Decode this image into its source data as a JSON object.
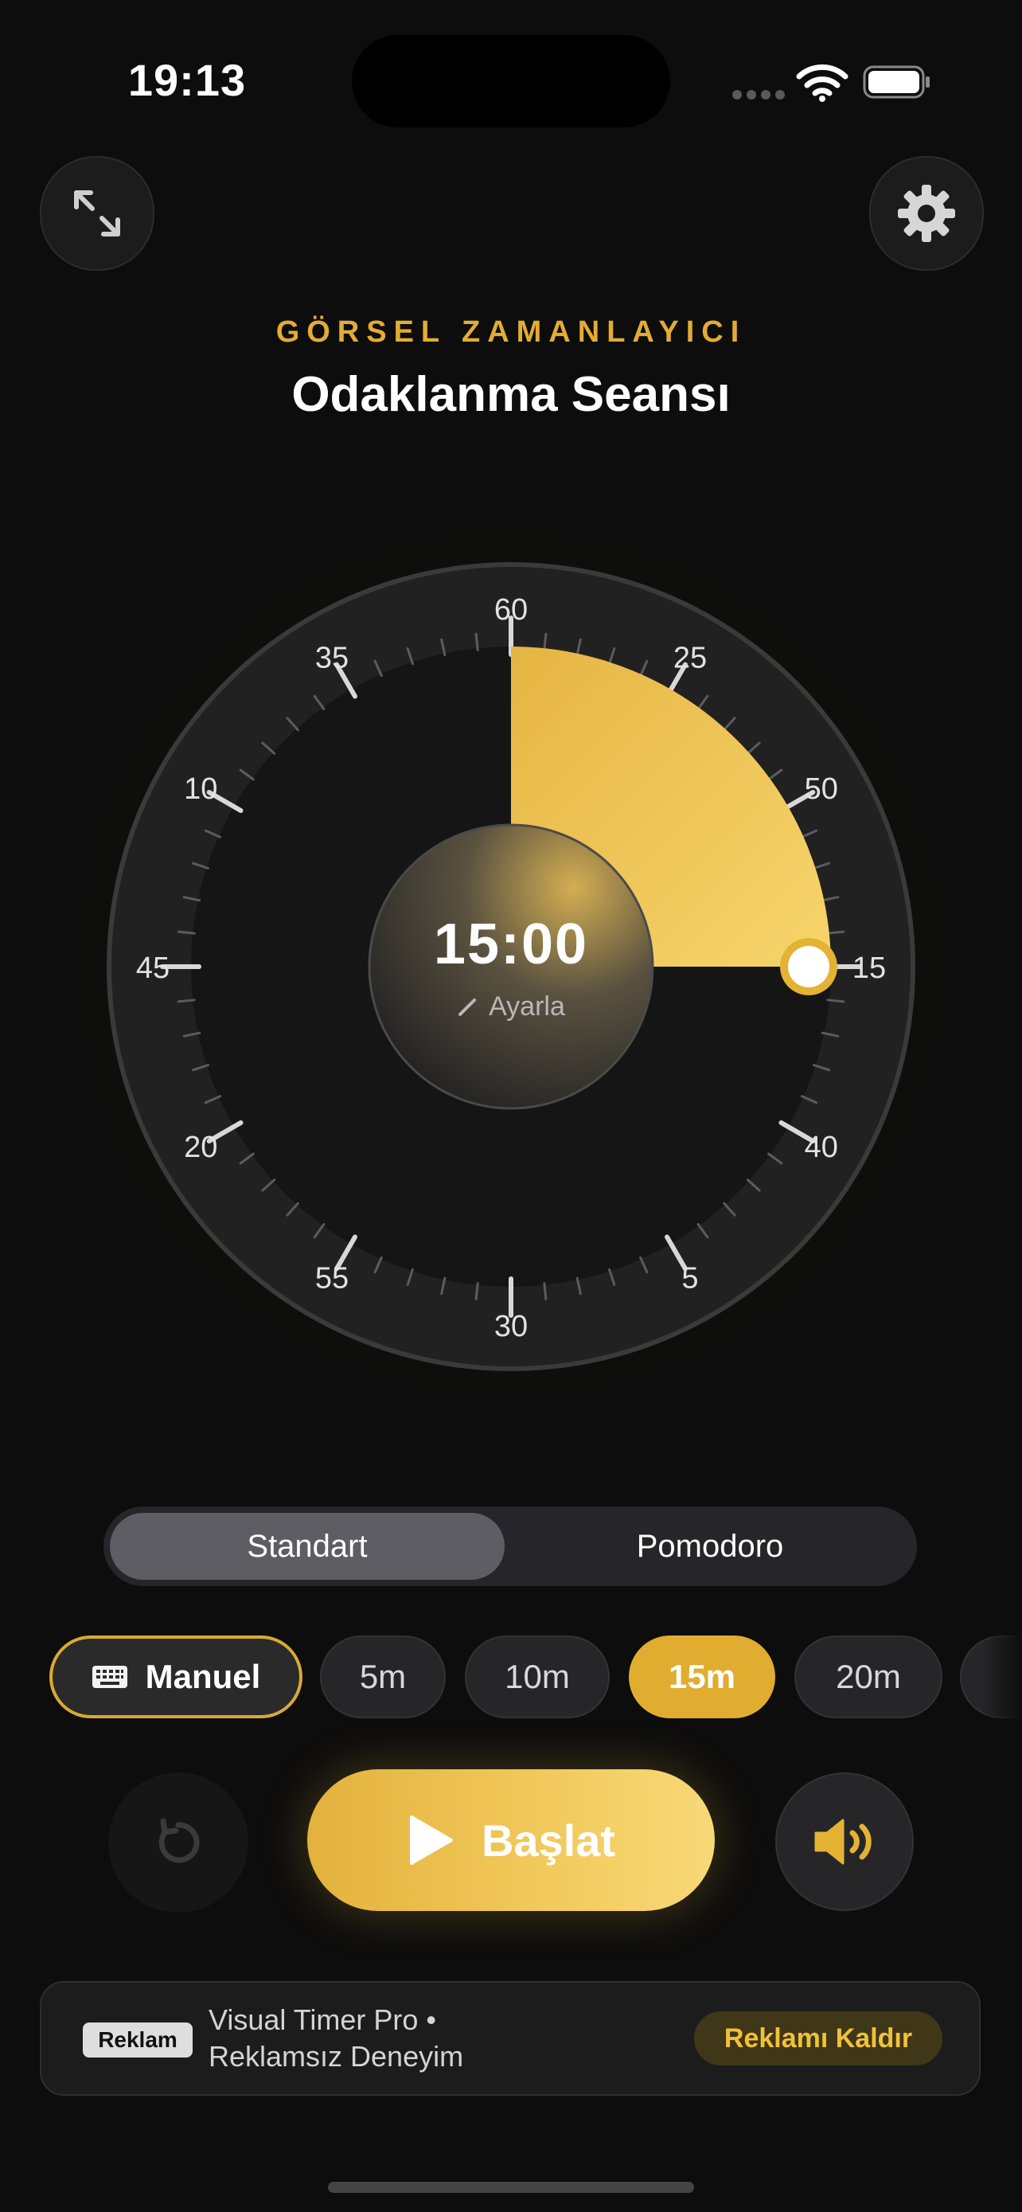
{
  "status_bar": {
    "time": "19:13"
  },
  "header": {
    "eyebrow": "GÖRSEL ZAMANLAYICI",
    "title": "Odaklanma Seansı"
  },
  "dial": {
    "labels": [
      "60",
      "25",
      "50",
      "15",
      "40",
      "5",
      "30",
      "55",
      "20",
      "45",
      "10",
      "35"
    ],
    "remaining_time": "15:00",
    "adjust_label": "Ayarla",
    "selected_minutes": 15,
    "total_minutes": 60,
    "accent": "#e9b93e"
  },
  "mode_segment": {
    "options": [
      "Standart",
      "Pomodoro"
    ],
    "selected": "Standart"
  },
  "presets": {
    "manual_label": "Manuel",
    "chips": [
      "5m",
      "10m",
      "15m",
      "20m"
    ],
    "selected": "15m"
  },
  "controls": {
    "start_label": "Başlat"
  },
  "ad": {
    "tag": "Reklam",
    "line1": "Visual Timer Pro •",
    "line2": "Reklamsız Deneyim",
    "remove_label": "Reklamı Kaldır"
  },
  "icons": {
    "expand": "expand-icon",
    "settings": "gear-icon",
    "wifi": "wifi-icon",
    "battery": "battery-icon",
    "pencil": "pencil-icon",
    "keyboard": "keyboard-icon",
    "reset": "reset-icon",
    "play": "play-icon",
    "sound": "speaker-icon"
  }
}
